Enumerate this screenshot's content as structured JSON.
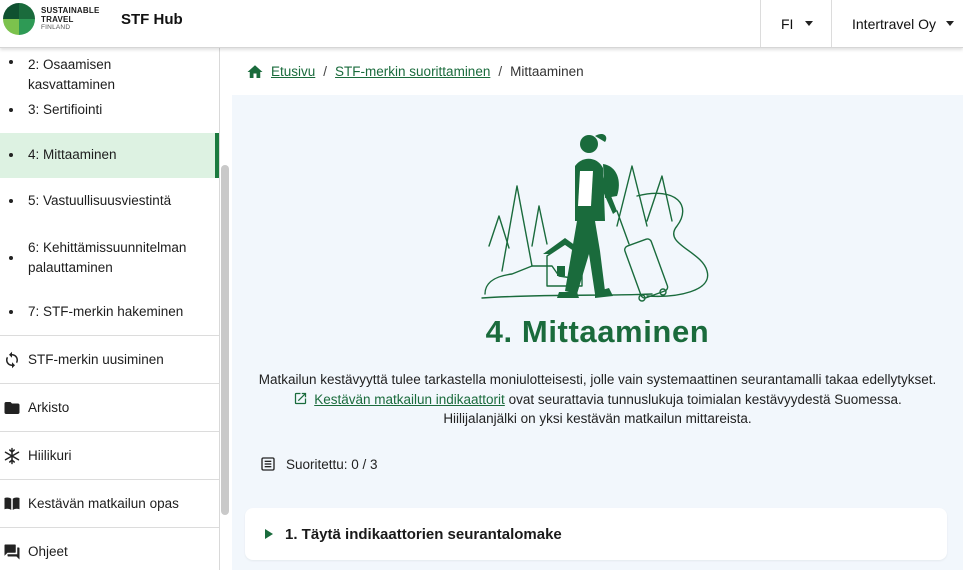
{
  "header": {
    "logo_lines": [
      "SUSTAINABLE",
      "TRAVEL",
      "FINLAND"
    ],
    "app_title": "STF Hub",
    "language": "FI",
    "organization": "Intertravel Oy"
  },
  "sidebar": {
    "sub_items": [
      {
        "label": "2: Osaamisen kasvattaminen"
      },
      {
        "label": "3: Sertifiointi"
      },
      {
        "label": "4: Mittaaminen",
        "active": true
      },
      {
        "label": "5: Vastuullisuusviestintä"
      },
      {
        "label": "6: Kehittämissuunnitelman palauttaminen"
      },
      {
        "label": "7: STF-merkin hakeminen"
      }
    ],
    "main_items": [
      {
        "label": "STF-merkin uusiminen",
        "icon": "refresh-icon"
      },
      {
        "label": "Arkisto",
        "icon": "folder-icon"
      },
      {
        "label": "Hiilikuri",
        "icon": "snowflake-icon"
      },
      {
        "label": "Kestävän matkailun opas",
        "icon": "book-icon"
      },
      {
        "label": "Ohjeet",
        "icon": "chat-icon"
      }
    ]
  },
  "breadcrumb": {
    "home": "Etusivu",
    "parent": "STF-merkin suorittaminen",
    "current": "Mittaaminen"
  },
  "main": {
    "title": "4. Mittaaminen",
    "desc_line1": "Matkailun kestävyyttä tulee tarkastella moniulotteisesti, jolle vain systemaattinen seurantamalli takaa edellytykset.",
    "link_text": "Kestävän matkailun indikaattorit",
    "desc_line2_rest": " ovat seurattavia tunnuslukuja toimialan kestävyydestä Suomessa.",
    "desc_line3": "Hiilijalanjälki on yksi kestävän matkailun mittareista.",
    "progress": "Suoritettu: 0 / 3",
    "card_title": "1. Täytä indikaattorien seurantalomake"
  },
  "colors": {
    "brand_green": "#1a6b3c",
    "active_bg": "#ddf2e2",
    "content_bg": "#f2f7fc"
  }
}
